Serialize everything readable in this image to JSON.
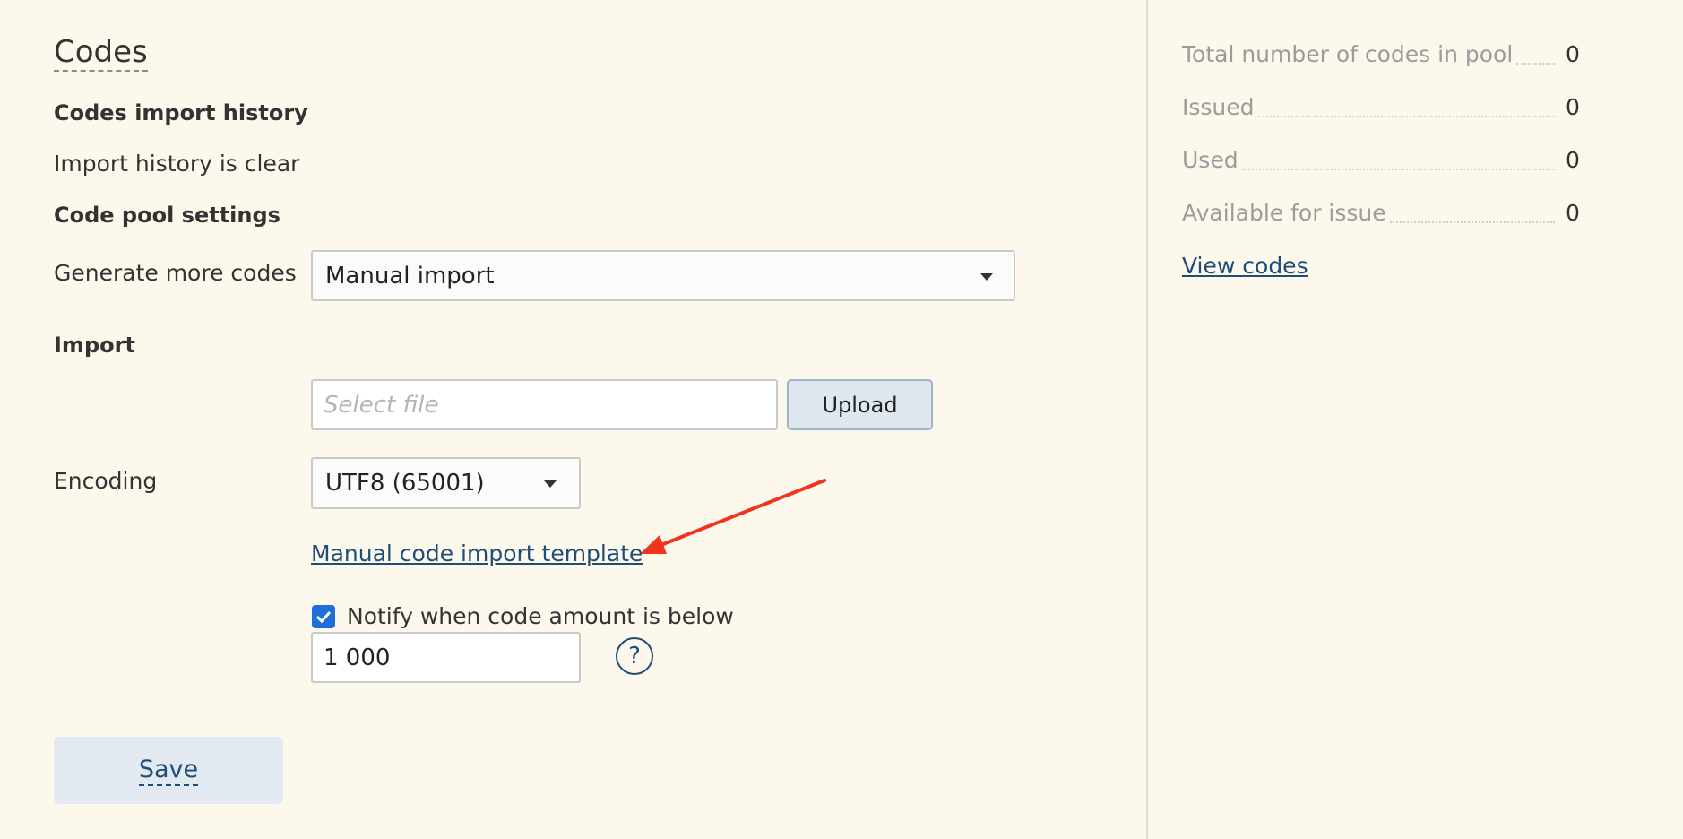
{
  "page": {
    "title": "Codes",
    "history_heading": "Codes import history",
    "history_status": "Import history is clear",
    "settings_heading": "Code pool settings",
    "generate_label": "Generate more codes",
    "generate_value": "Manual import",
    "import_heading": "Import",
    "file_placeholder": "Select file",
    "upload_label": "Upload",
    "encoding_label": "Encoding",
    "encoding_value": "UTF8 (65001)",
    "template_link": "Manual code import template",
    "notify_label": "Notify when code amount is below",
    "notify_checked": true,
    "notify_threshold": "1 000",
    "help_symbol": "?",
    "save_label": "Save"
  },
  "stats": {
    "rows": [
      {
        "label": "Total number of codes in pool",
        "value": "0"
      },
      {
        "label": "Issued",
        "value": "0"
      },
      {
        "label": "Used",
        "value": "0"
      },
      {
        "label": "Available for issue",
        "value": "0"
      }
    ],
    "view_link": "View codes"
  },
  "annotation": {
    "arrow_color": "#f0341d"
  },
  "colors": {
    "background": "#fdf8ec",
    "link": "#1e4d78",
    "checkbox": "#1e6fd9"
  }
}
